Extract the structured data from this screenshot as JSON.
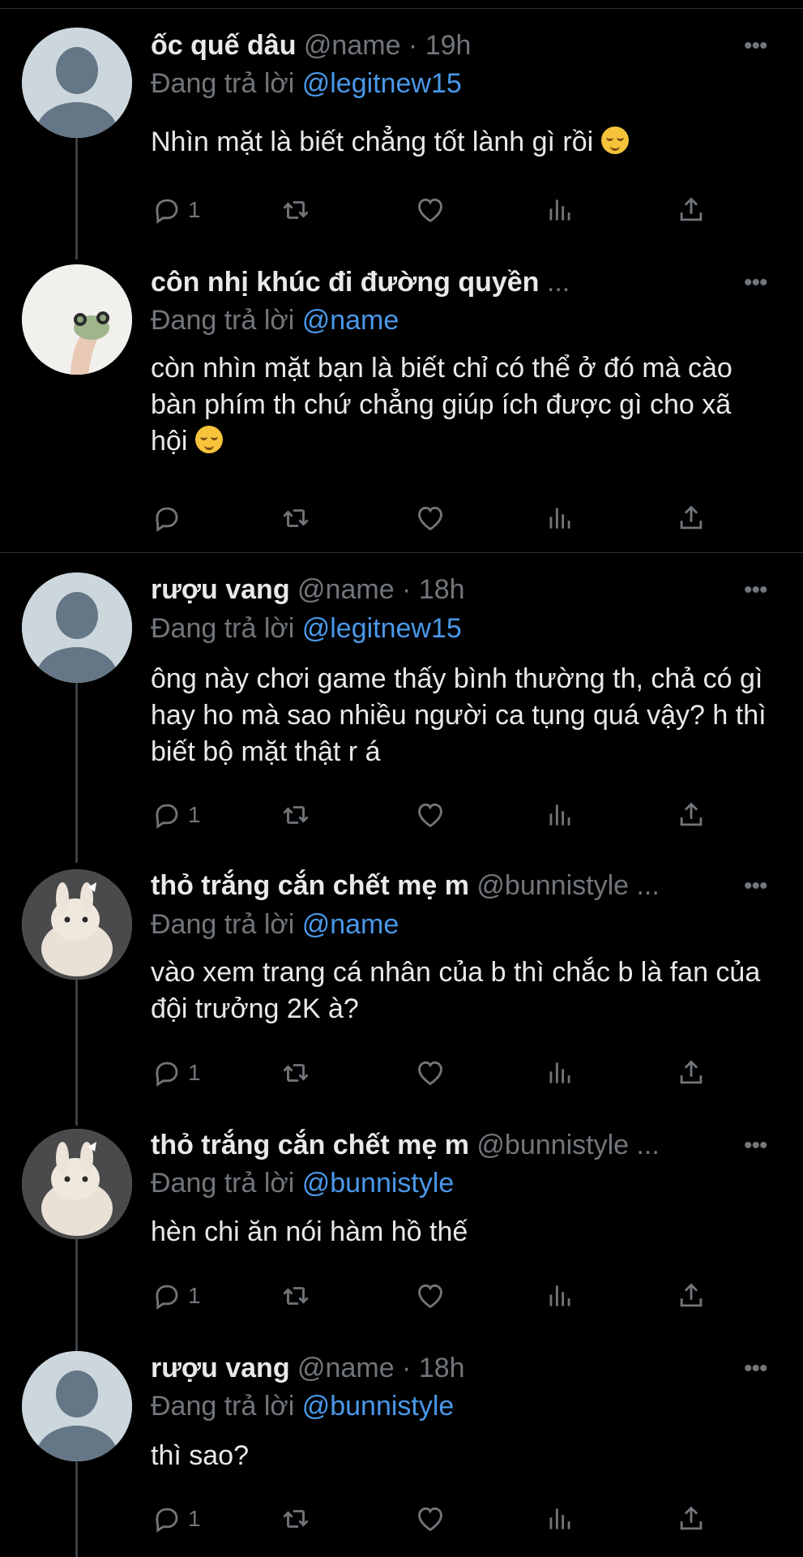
{
  "replying_prefix": "Đang trả lời",
  "tweets": [
    {
      "name": "ốc quế dâu",
      "meta": "@name · 19h",
      "reply_to": "@legitnew15",
      "text": "Nhìn mặt là biết chẳng tốt lành gì rồi",
      "emoji": "relieved-face",
      "reply_count": "1",
      "avatar": "default"
    },
    {
      "name": "côn nhị khúc đi đường quyền",
      "meta": "...",
      "reply_to": "@name",
      "text": "còn nhìn mặt bạn là biết chỉ có thể ở đó mà cào bàn phím th chứ chẳng giúp ích được gì cho xã hội",
      "emoji": "relieved-face",
      "reply_count": "",
      "avatar": "frog-photo"
    },
    {
      "name": "rượu vang",
      "meta": "@name · 18h",
      "reply_to": "@legitnew15",
      "text": "ông này chơi game thấy bình thường th, chả có gì hay ho mà sao nhiều người ca tụng quá vậy? h thì biết bộ mặt thật r á",
      "reply_count": "1",
      "avatar": "default"
    },
    {
      "name": "thỏ trắng cắn chết mẹ m",
      "meta": "@bunnistyle ...",
      "reply_to": "@name",
      "text": "vào xem trang cá nhân của b thì chắc b là fan của đội trưởng 2K à?",
      "reply_count": "1",
      "avatar": "bunny-photo"
    },
    {
      "name": "thỏ trắng cắn chết mẹ m",
      "meta": "@bunnistyle ...",
      "reply_to": "@bunnistyle",
      "text": "hèn chi ăn nói hàm hồ thế",
      "reply_count": "1",
      "avatar": "bunny-photo"
    },
    {
      "name": "rượu vang",
      "meta": "@name · 18h",
      "reply_to": "@bunnistyle",
      "text": "thì sao?",
      "reply_count": "1",
      "avatar": "default"
    }
  ],
  "icons": [
    "reply-icon",
    "retweet-icon",
    "like-icon",
    "analytics-icon",
    "share-icon",
    "more-icon"
  ],
  "colors": {
    "background": "#000000",
    "text": "#e7e9ea",
    "muted": "#71767b",
    "mention": "#4a98e9",
    "divider": "#2f3336"
  }
}
